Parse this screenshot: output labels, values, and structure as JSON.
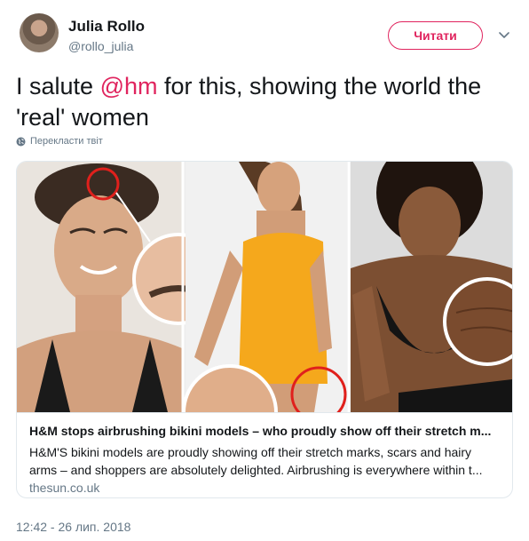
{
  "author": {
    "name": "Julia Rollo",
    "handle": "@rollo_julia"
  },
  "follow_label": "Читати",
  "tweet": {
    "text_before": "I salute ",
    "mention": "@hm",
    "text_after": " for this, showing the world the 'real' women"
  },
  "translate_label": "Перекласти твіт",
  "card": {
    "title": "H&M stops airbrushing bikini models – who proudly show off their stretch m...",
    "description": "H&M'S bikini models are proudly showing off their stretch marks, scars and hairy arms – and shoppers are absolutely delighted. Airbrushing is everywhere within t...",
    "domain": "thesun.co.uk"
  },
  "timestamp": "12:42 - 26 лип. 2018",
  "colors": {
    "accent": "#e0245e",
    "secondary_text": "#657786",
    "swimsuit_yellow": "#f5a81c",
    "highlight_circle": "#e0201c"
  },
  "icons": {
    "translate": "globe-icon",
    "more": "chevron-down-icon"
  }
}
